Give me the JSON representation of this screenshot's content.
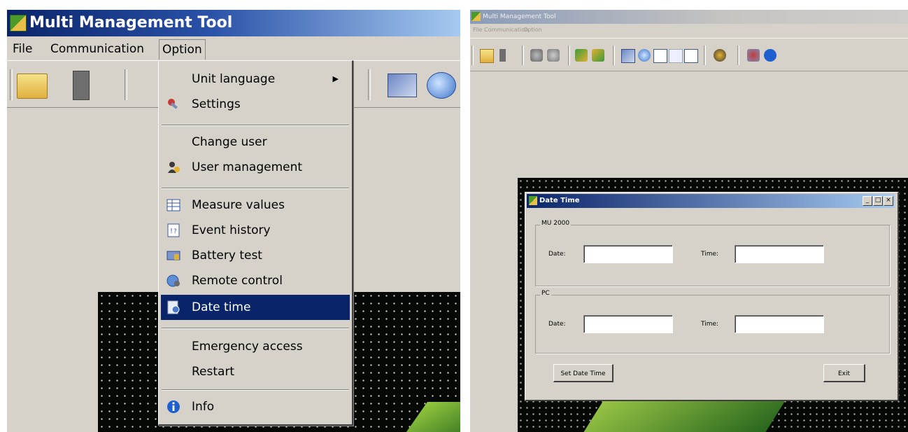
{
  "left": {
    "title": "Multi Management Tool",
    "menubar": [
      "File",
      "Communication",
      "Option"
    ],
    "option_menu": {
      "items": [
        {
          "label": "Unit language",
          "submenu_arrow": "▶"
        },
        {
          "label": "Settings",
          "icon": "settings-icon"
        },
        {
          "label": "Change user"
        },
        {
          "label": "User management",
          "icon": "user-management-icon"
        },
        {
          "label": "Measure values",
          "icon": "measure-values-icon"
        },
        {
          "label": "Event history",
          "icon": "event-history-icon"
        },
        {
          "label": "Battery test",
          "icon": "battery-test-icon"
        },
        {
          "label": "Remote control",
          "icon": "remote-control-icon"
        },
        {
          "label": "Date time",
          "icon": "date-time-icon",
          "selected": true
        },
        {
          "label": "Emergency access"
        },
        {
          "label": "Restart"
        },
        {
          "label": "Info",
          "icon": "info-icon"
        }
      ]
    }
  },
  "right": {
    "title": "Multi Management Tool",
    "menubar": [
      "File",
      "Communication",
      "Option"
    ],
    "dialog": {
      "title": "Date Time",
      "window_buttons": [
        "_",
        "□",
        "×"
      ],
      "group1": {
        "label": "MU 2000",
        "date_label": "Date:",
        "time_label": "Time:",
        "date_value": "",
        "time_value": ""
      },
      "group2": {
        "label": "PC",
        "date_label": "Date:",
        "time_label": "Time:",
        "date_value": "",
        "time_value": ""
      },
      "set_button": "Set Date Time",
      "exit_button": "Exit"
    }
  },
  "colors": {
    "selection": "#0a246a",
    "face": "#d6d2c9",
    "info": "#1f5fd0"
  }
}
